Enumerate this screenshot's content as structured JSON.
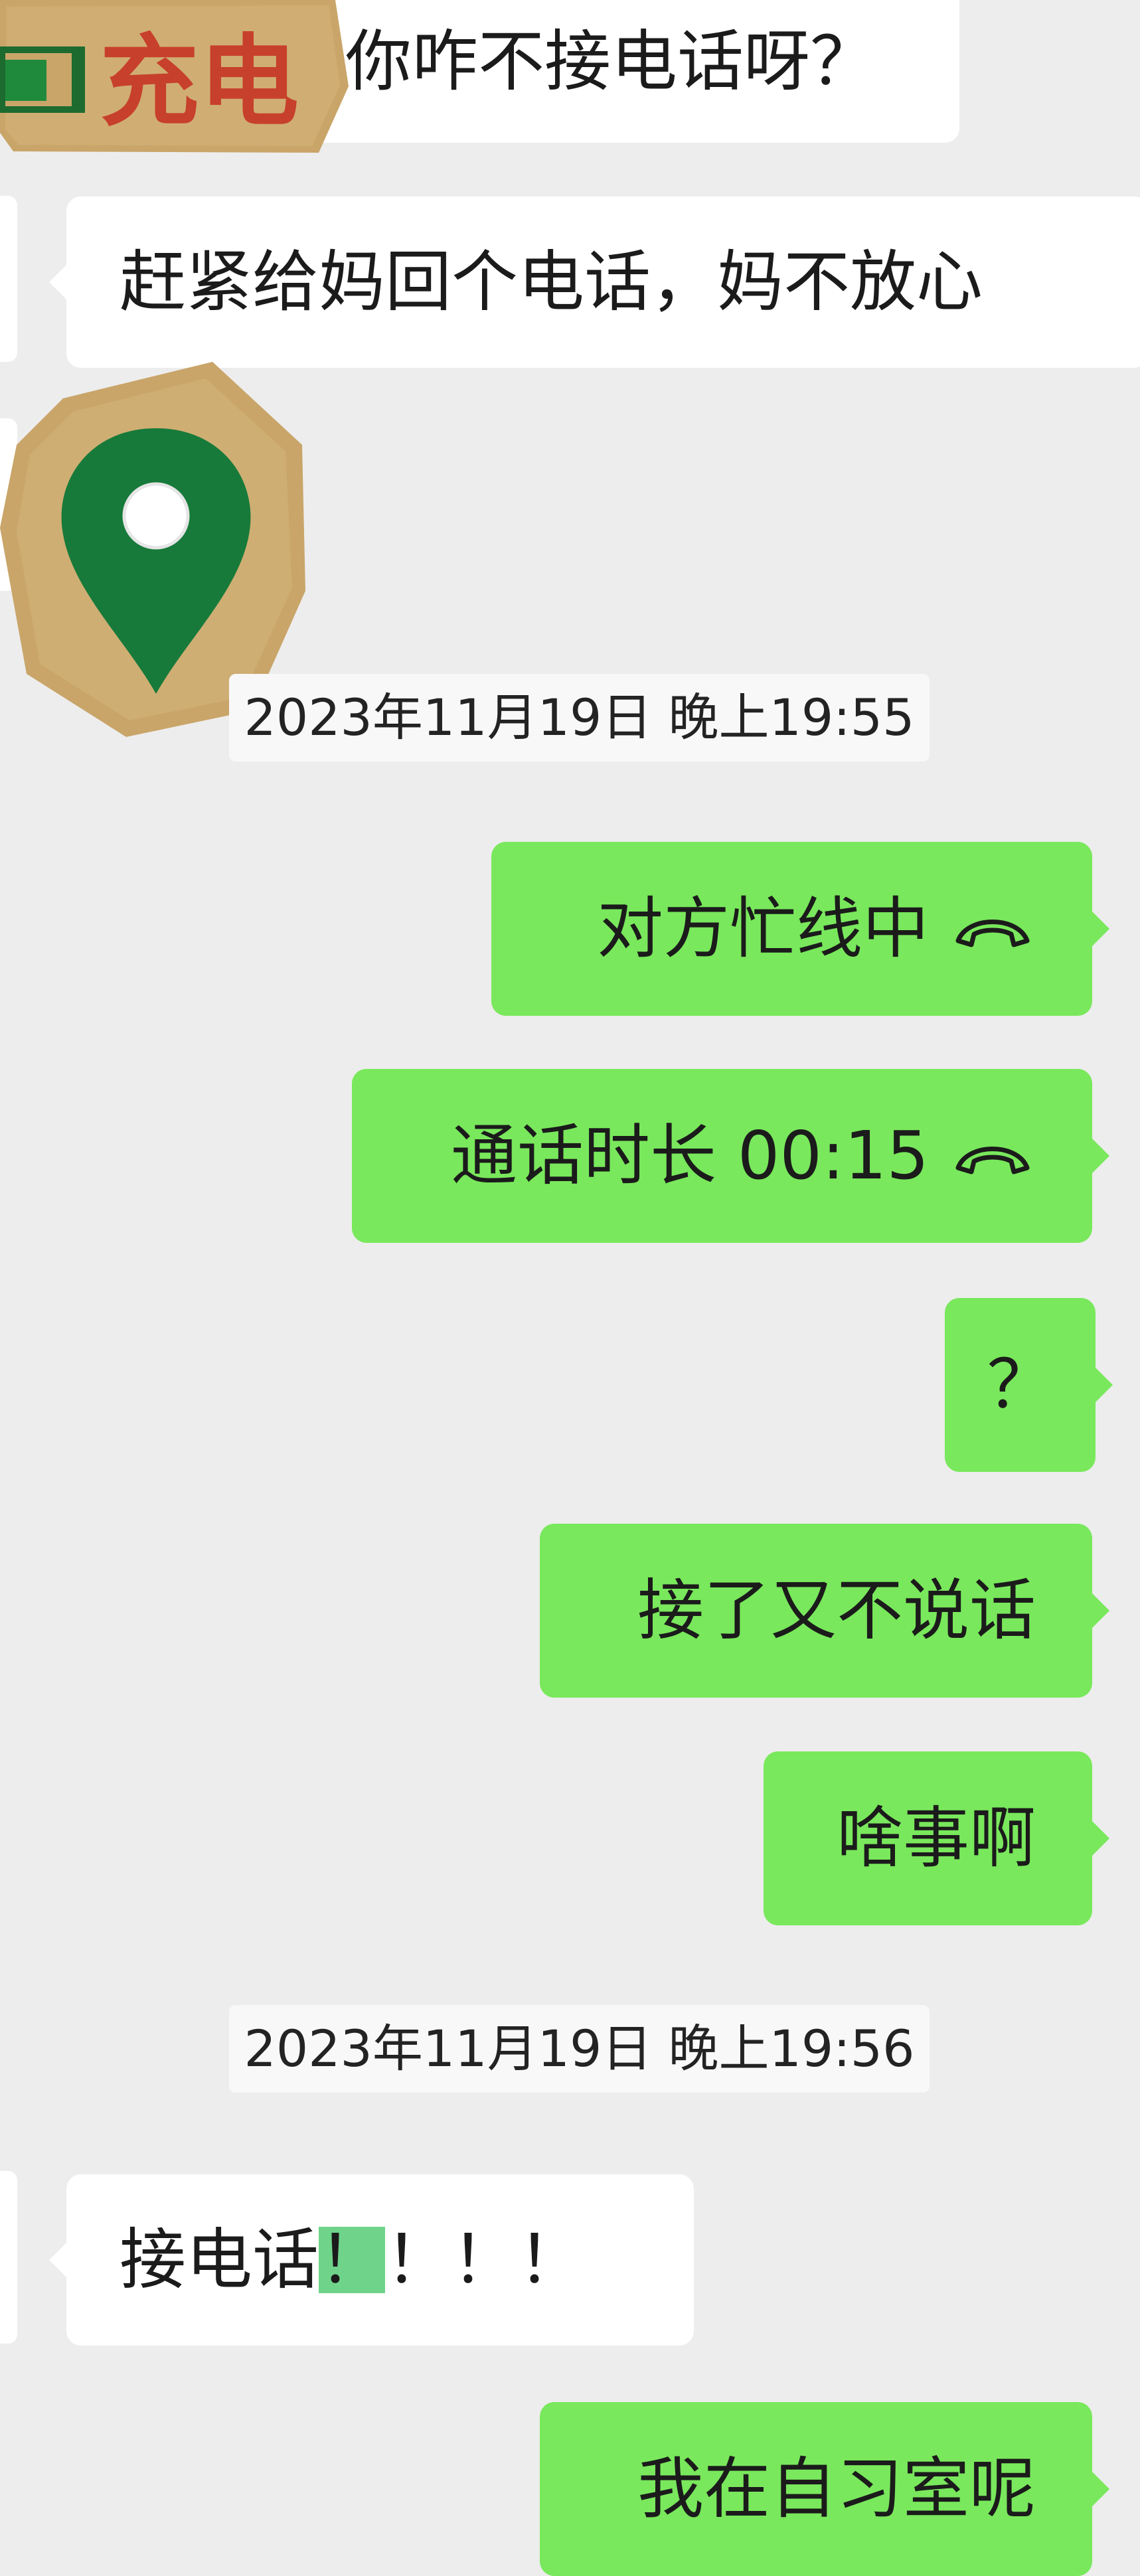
{
  "colors": {
    "background": "#ededed",
    "incoming_bubble": "#ffffff",
    "outgoing_bubble": "#79e85c",
    "highlight": "#6fd48a",
    "sticker_cardboard": "#c9a569",
    "sticker_green": "#177a3a",
    "sticker_red": "#c7402b"
  },
  "stickers": {
    "battery_text": "充电",
    "location_pin_icon": "location-pin-icon"
  },
  "messages": {
    "m1": "你咋不接电话呀？",
    "m2": "赶紧给妈回个电话，妈不放心",
    "t1": "2023年11月19日 晚上19:55",
    "m3": "对方忙线中",
    "m4": "通话时长 00:15",
    "m5": "？",
    "m6": "接了又不说话",
    "m7": "啥事啊",
    "t2": "2023年11月19日 晚上19:56",
    "m8_a": "接电话",
    "m8_b": "！",
    "m8_c": "！！！",
    "m9": "我在自习室呢"
  }
}
